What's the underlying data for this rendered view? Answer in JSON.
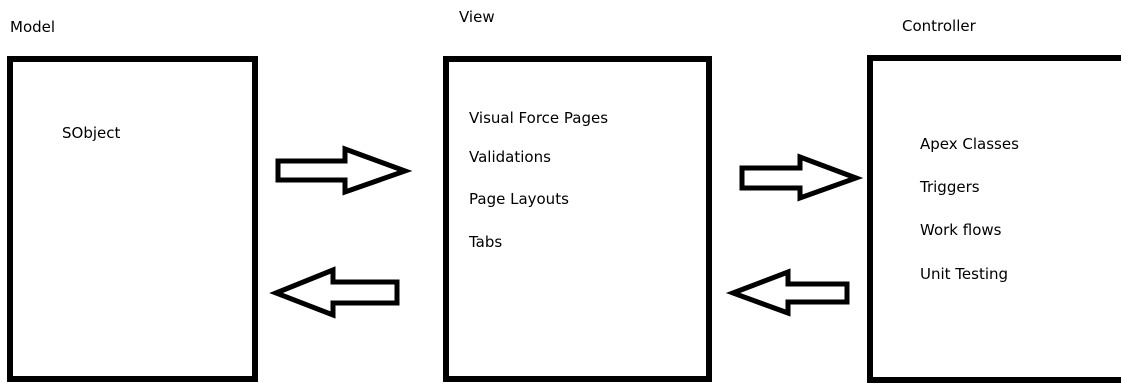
{
  "model": {
    "title": "Model",
    "items": [
      "SObject"
    ]
  },
  "view": {
    "title": "View",
    "items": [
      "Visual Force Pages",
      "Validations",
      "Page Layouts",
      "Tabs"
    ]
  },
  "controller": {
    "title": "Controller",
    "items": [
      "Apex Classes",
      "Triggers",
      "Work flows",
      "Unit Testing"
    ]
  },
  "arrows": [
    {
      "name": "model-to-view-arrow",
      "direction": "right"
    },
    {
      "name": "view-to-model-arrow",
      "direction": "left"
    },
    {
      "name": "view-to-controller-arrow",
      "direction": "right"
    },
    {
      "name": "controller-to-view-arrow",
      "direction": "left"
    }
  ]
}
